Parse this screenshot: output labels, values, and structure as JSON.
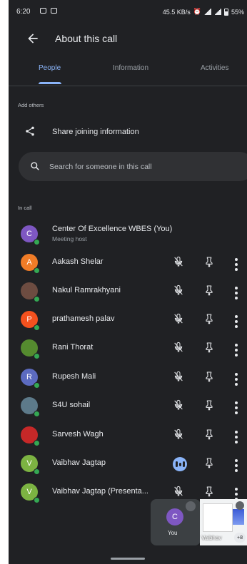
{
  "status_bar": {
    "time": "6:20",
    "net_speed": "45.5 KB/s",
    "battery": "55%"
  },
  "header": {
    "title": "About this call"
  },
  "tabs": [
    {
      "label": "People",
      "active": true
    },
    {
      "label": "Information",
      "active": false
    },
    {
      "label": "Activities",
      "active": false
    }
  ],
  "add_others": {
    "label": "Add others",
    "share_label": "Share joining information",
    "search_placeholder": "Search for someone in this call"
  },
  "in_call": {
    "label": "In call",
    "host": {
      "initial": "C",
      "name": "Center Of Excellence WBES (You)",
      "role": "Meeting host",
      "color": "#7e57c2"
    },
    "participants": [
      {
        "initial": "A",
        "name": "Aakash Shelar",
        "color": "#f07c27"
      },
      {
        "initial": "",
        "name": "Nakul Ramrakhyani",
        "color": "#6d4c41"
      },
      {
        "initial": "P",
        "name": "prathamesh palav",
        "color": "#f4511e"
      },
      {
        "initial": "",
        "name": "Rani Thorat",
        "color": "#558b2f"
      },
      {
        "initial": "R",
        "name": "Rupesh Mali",
        "color": "#5c6bc0"
      },
      {
        "initial": "",
        "name": "S4U sohail",
        "color": "#5d7a8a"
      },
      {
        "initial": "",
        "name": "Sarvesh Wagh",
        "color": "#c62828"
      },
      {
        "initial": "V",
        "name": "Vaibhav Jagtap",
        "color": "#7cb342"
      },
      {
        "initial": "V",
        "name": "Vaibhav Jagtap (Presenta...",
        "color": "#7cb342"
      }
    ]
  },
  "floating": {
    "self_initial": "C",
    "self_label": "You",
    "presenter_label": "Vaibhav",
    "extra_count": "+8"
  },
  "colors": {
    "accent": "#8ab4f8",
    "background": "#202124",
    "online": "#34a853"
  }
}
